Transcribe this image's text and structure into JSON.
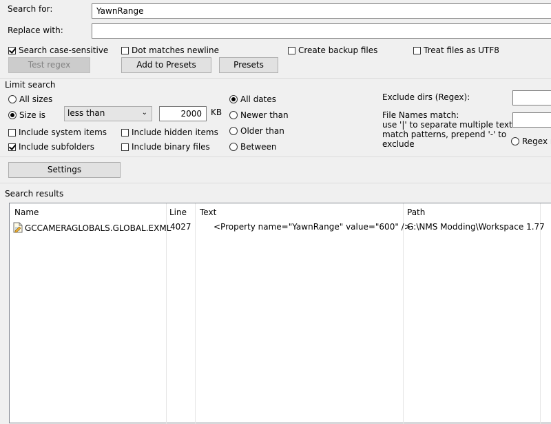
{
  "search": {
    "search_for_label": "Search for:",
    "search_for_value": "YawnRange",
    "replace_with_label": "Replace with:",
    "replace_with_value": ""
  },
  "options": {
    "case_sensitive": {
      "label": "Search case-sensitive",
      "checked": true
    },
    "dot_matches_newline": {
      "label": "Dot matches newline",
      "checked": false
    },
    "create_backup": {
      "label": "Create backup files",
      "checked": false
    },
    "treat_utf8": {
      "label": "Treat files as UTF8",
      "checked": false
    }
  },
  "buttons": {
    "test_regex": "Test regex",
    "add_to_presets": "Add to Presets",
    "presets": "Presets",
    "settings": "Settings"
  },
  "limit": {
    "title": "Limit search",
    "all_sizes": "All sizes",
    "size_is": "Size is",
    "size_op": "less than",
    "size_value": "2000",
    "size_unit": "KB",
    "include_system": "Include system items",
    "include_hidden": "Include hidden items",
    "include_subfolders": "Include subfolders",
    "include_binary": "Include binary files",
    "all_dates": "All dates",
    "newer_than": "Newer than",
    "older_than": "Older than",
    "between": "Between",
    "exclude_dirs_label": "Exclude dirs (Regex):",
    "exclude_dirs_value": "",
    "file_names_label": "File Names match:",
    "file_names_help": [
      "use '|' to separate multiple text",
      "match patterns, prepend '-' to",
      "exclude"
    ],
    "file_names_value": "",
    "regex_label": "Regex r"
  },
  "results": {
    "title": "Search results",
    "columns": [
      "Name",
      "Line",
      "Text",
      "Path"
    ],
    "rows": [
      {
        "name": "GCCAMERAGLOBALS.GLOBAL.EXML",
        "line": "4027",
        "text": "<Property name=\"YawnRange\" value=\"600\" />",
        "path": "G:\\NMS Modding\\Workspace 1.77"
      }
    ]
  }
}
